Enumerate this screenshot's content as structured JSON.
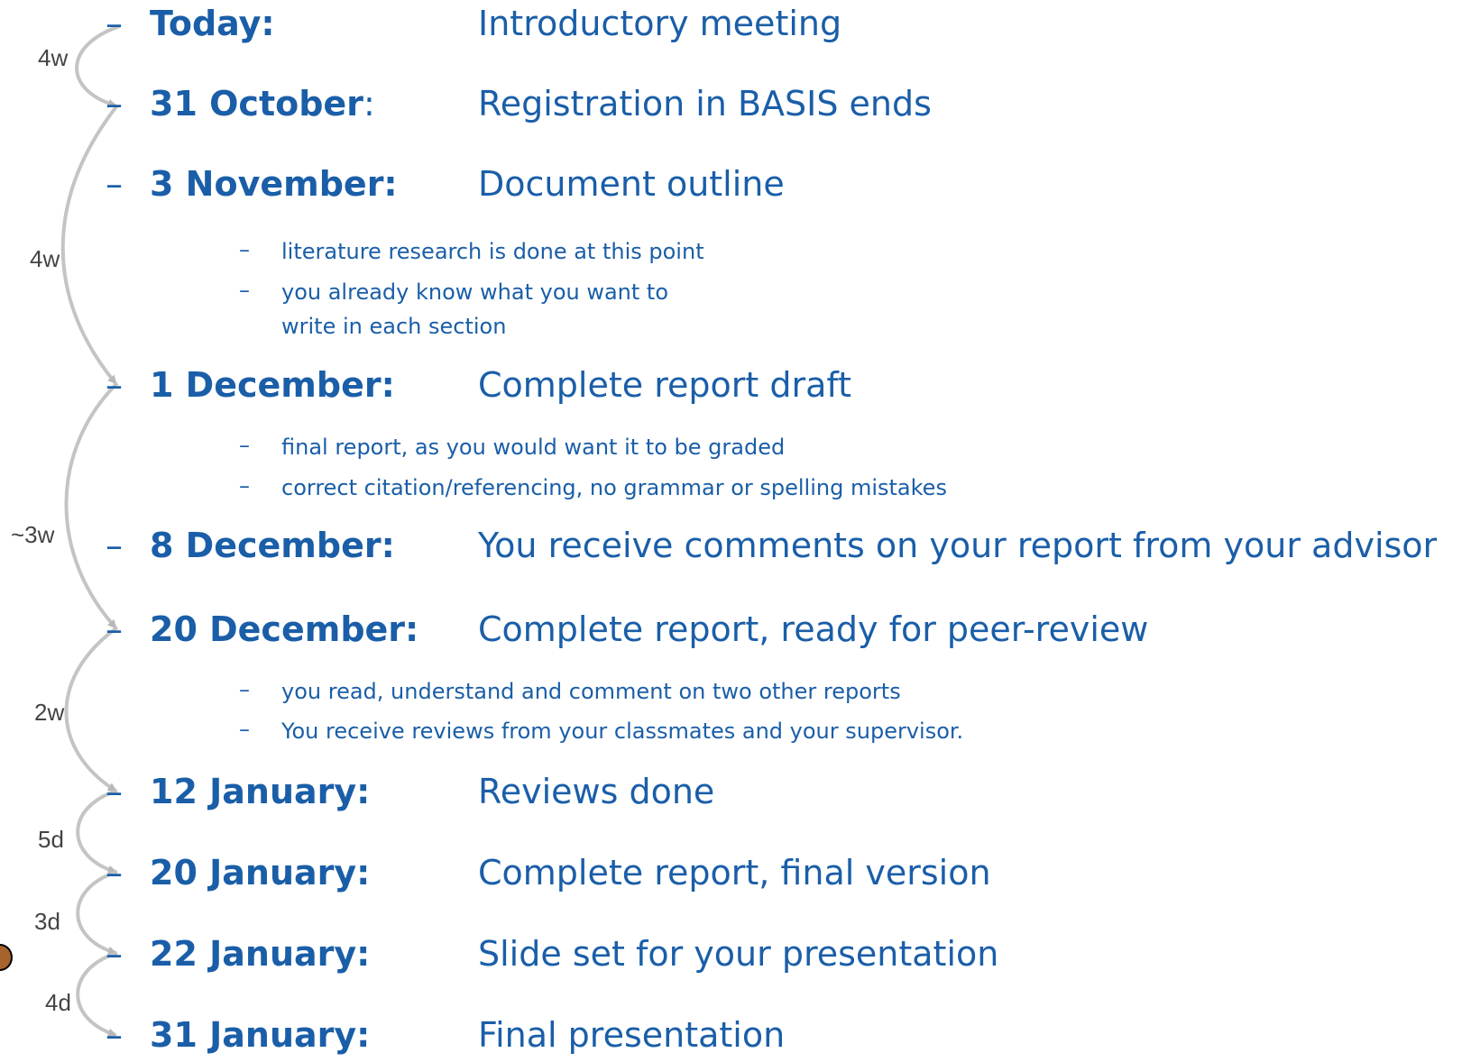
{
  "milestones": [
    {
      "date": "Today:",
      "colon": "",
      "task": "Introductory meeting"
    },
    {
      "date": "31 October",
      "colon": ":",
      "task": "Registration in BASIS ends"
    },
    {
      "date": "3 November:",
      "colon": "",
      "task": "Document outline"
    },
    {
      "date": "1 December:",
      "colon": "",
      "task": "Complete report draft"
    },
    {
      "date": "8 December:",
      "colon": "",
      "task": "You receive comments on your report from your advisor"
    },
    {
      "date": "20 December:",
      "colon": "",
      "task": "Complete report, ready for peer-review"
    },
    {
      "date": "12 January:",
      "colon": "",
      "task": "Reviews done"
    },
    {
      "date": "20 January:",
      "colon": "",
      "task": "Complete report, final version"
    },
    {
      "date": "22 January:",
      "colon": "",
      "task": "Slide set for your presentation"
    },
    {
      "date": "31 January:",
      "colon": "",
      "task": "Final presentation"
    }
  ],
  "notes": {
    "outline": [
      "literature research is done at this point",
      "you already know what you want to write in each section"
    ],
    "draft": [
      "final report, as you would want it to be graded",
      "correct citation/referencing, no grammar or spelling mistakes"
    ],
    "peer_review": [
      "you read, understand and comment on two other reports",
      "You receive reviews from your classmates and your supervisor."
    ]
  },
  "bullet": "–",
  "gaps": [
    "4w",
    "4w",
    "~3w",
    "2w",
    "5d",
    "3d",
    "4d"
  ],
  "colors": {
    "text": "#1a5ea8",
    "arc": "#c0c0c0",
    "gap_label": "#444444"
  }
}
